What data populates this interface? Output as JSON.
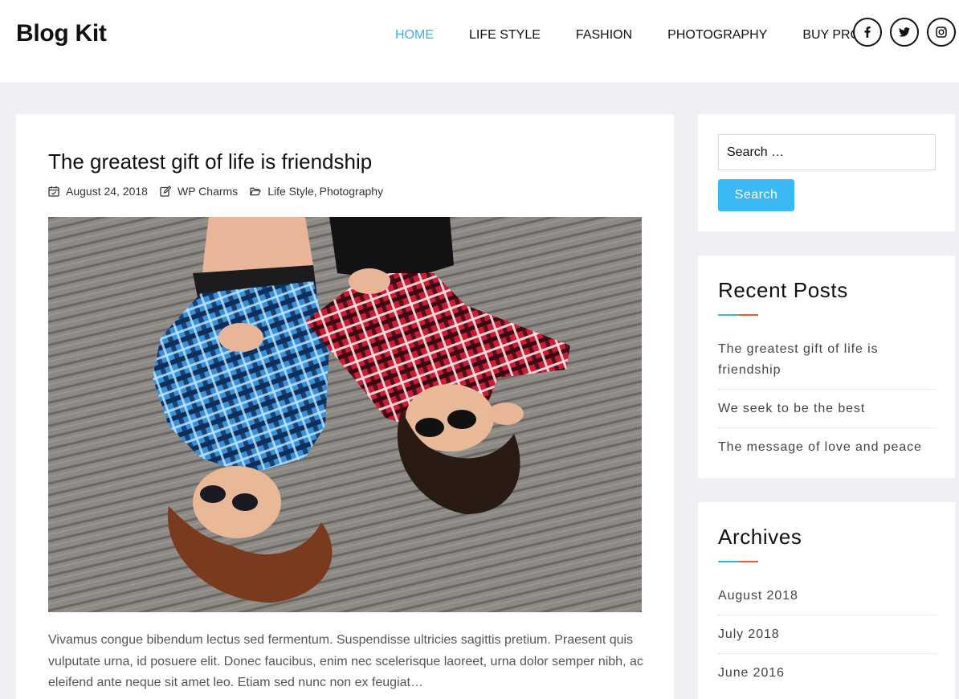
{
  "site": {
    "title": "Blog Kit"
  },
  "nav": {
    "items": [
      {
        "label": "HOME",
        "active": true
      },
      {
        "label": "LIFE STYLE",
        "active": false
      },
      {
        "label": "FASHION",
        "active": false
      },
      {
        "label": "PHOTOGRAPHY",
        "active": false
      },
      {
        "label": "BUY PRO",
        "active": false
      }
    ],
    "social": [
      "facebook-icon",
      "twitter-icon",
      "instagram-icon"
    ]
  },
  "post": {
    "title": "The greatest gift of life is friendship",
    "date": "August 24, 2018",
    "author": "WP Charms",
    "categories": [
      "Life Style",
      "Photography"
    ],
    "category_separator": ",",
    "excerpt": "Vivamus congue bibendum lectus sed fermentum. Suspendisse ultricies sagittis pretium. Praesent quis vulputate urna, id posuere elit. Donec faucibus, enim nec scelerisque laoreet, urna dolor semper nibh, ac eleifend ante neque sit amet leo. Etiam sed nunc non ex feugiat…"
  },
  "sidebar": {
    "search": {
      "placeholder": "Search …",
      "button_label": "Search"
    },
    "recent_posts": {
      "title": "Recent Posts",
      "items": [
        "The greatest gift of life is friendship",
        "We seek to be the best",
        "The message of love and peace"
      ]
    },
    "archives": {
      "title": "Archives",
      "items": [
        "August 2018",
        "July 2018",
        "June 2016"
      ]
    }
  },
  "colors": {
    "accent": "#3ab0e6",
    "accent_secondary": "#f05a28",
    "button": "#3ab9f5",
    "page_background": "#eeeff3"
  }
}
